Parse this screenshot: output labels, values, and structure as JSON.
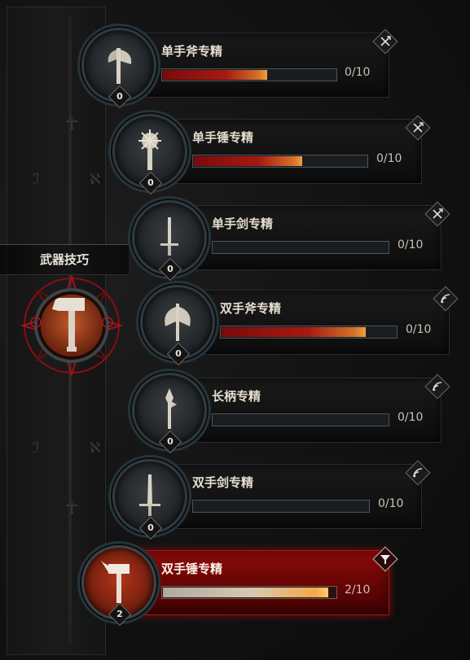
{
  "branch": {
    "title": "武器技巧"
  },
  "skills": [
    {
      "name": "单手斧专精",
      "rank": "0",
      "progress_text": "0/10",
      "progress_fill": 0.6,
      "weapon_icon": "axe-icon",
      "type_icon": "crossed-axes-icon",
      "active": false
    },
    {
      "name": "单手锤专精",
      "rank": "0",
      "progress_text": "0/10",
      "progress_fill": 0.6,
      "weapon_icon": "mace-icon",
      "type_icon": "crossed-axes-icon",
      "active": false
    },
    {
      "name": "单手剑专精",
      "rank": "0",
      "progress_text": "0/10",
      "progress_fill": 0,
      "weapon_icon": "sword-icon",
      "type_icon": "crossed-axes-icon",
      "active": false
    },
    {
      "name": "双手斧专精",
      "rank": "0",
      "progress_text": "0/10",
      "progress_fill": 0.8,
      "weapon_icon": "battle-axe-icon",
      "type_icon": "signal-arcs-icon",
      "active": false
    },
    {
      "name": "长柄专精",
      "rank": "0",
      "progress_text": "0/10",
      "progress_fill": 0,
      "weapon_icon": "polearm-icon",
      "type_icon": "signal-arcs-icon",
      "active": false
    },
    {
      "name": "双手剑专精",
      "rank": "0",
      "progress_text": "0/10",
      "progress_fill": 0,
      "weapon_icon": "greatsword-icon",
      "type_icon": "signal-arcs-icon",
      "active": false
    },
    {
      "name": "双手锤专精",
      "rank": "2",
      "progress_text": "2/10",
      "progress_fill": 0.95,
      "weapon_icon": "warhammer-icon",
      "type_icon": "funnel-icon",
      "active": true
    }
  ],
  "colors": {
    "accent_red": "#8d0a0a",
    "progress_orange": "#f0a040",
    "text_light": "#e4ddcf"
  }
}
